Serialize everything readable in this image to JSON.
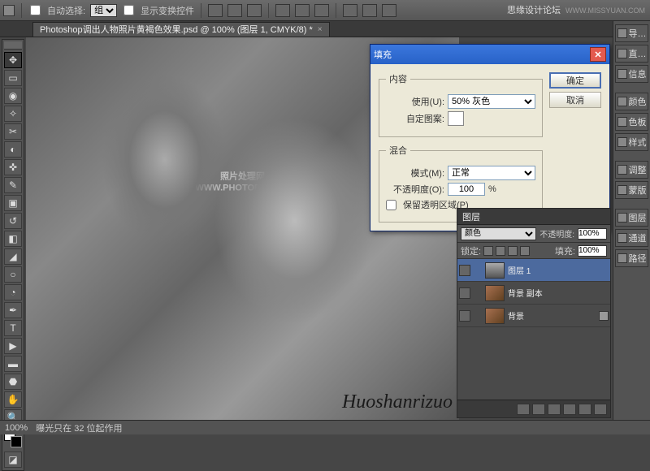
{
  "brand": {
    "name": "思缘设计论坛",
    "url": "WWW.MISSYUAN.COM"
  },
  "options": {
    "auto_select": "自动选择:",
    "group": "组",
    "show_transform": "显示变换控件"
  },
  "document_tab": "Photoshop调出人物照片黄褐色效果.psd @ 100% (图层 1, CMYK/8) *",
  "dialog": {
    "title": "填充",
    "content_group": "内容",
    "use_label": "使用(U):",
    "use_value": "50% 灰色",
    "custom_pattern": "自定图案:",
    "blend_group": "混合",
    "mode_label": "模式(M):",
    "mode_value": "正常",
    "opacity_label": "不透明度(O):",
    "opacity_value": "100",
    "percent": "%",
    "preserve_trans": "保留透明区域(P)",
    "ok": "确定",
    "cancel": "取消"
  },
  "watermark": {
    "line1": "照片处理网",
    "line2": "WWW.PHOTOPS.COM"
  },
  "signature": "Huoshanrizuo",
  "layers_panel": {
    "title": "图层",
    "blend_mode": "颜色",
    "opacity_label": "不透明度:",
    "opacity": "100%",
    "lock_label": "锁定:",
    "fill_label": "填充:",
    "fill": "100%",
    "rows": [
      {
        "name": "图层 1",
        "selected": true,
        "thumb": "bw"
      },
      {
        "name": "背景 副本",
        "selected": false,
        "thumb": "col"
      },
      {
        "name": "背景",
        "selected": false,
        "thumb": "col",
        "locked": true
      }
    ]
  },
  "right_dock": [
    "导…",
    "直…",
    "信息",
    "颜色",
    "色板",
    "样式",
    "调整",
    "蒙版",
    "图层",
    "通道",
    "路径"
  ],
  "status": {
    "zoom": "100%",
    "info": "曝光只在 32 位起作用"
  }
}
